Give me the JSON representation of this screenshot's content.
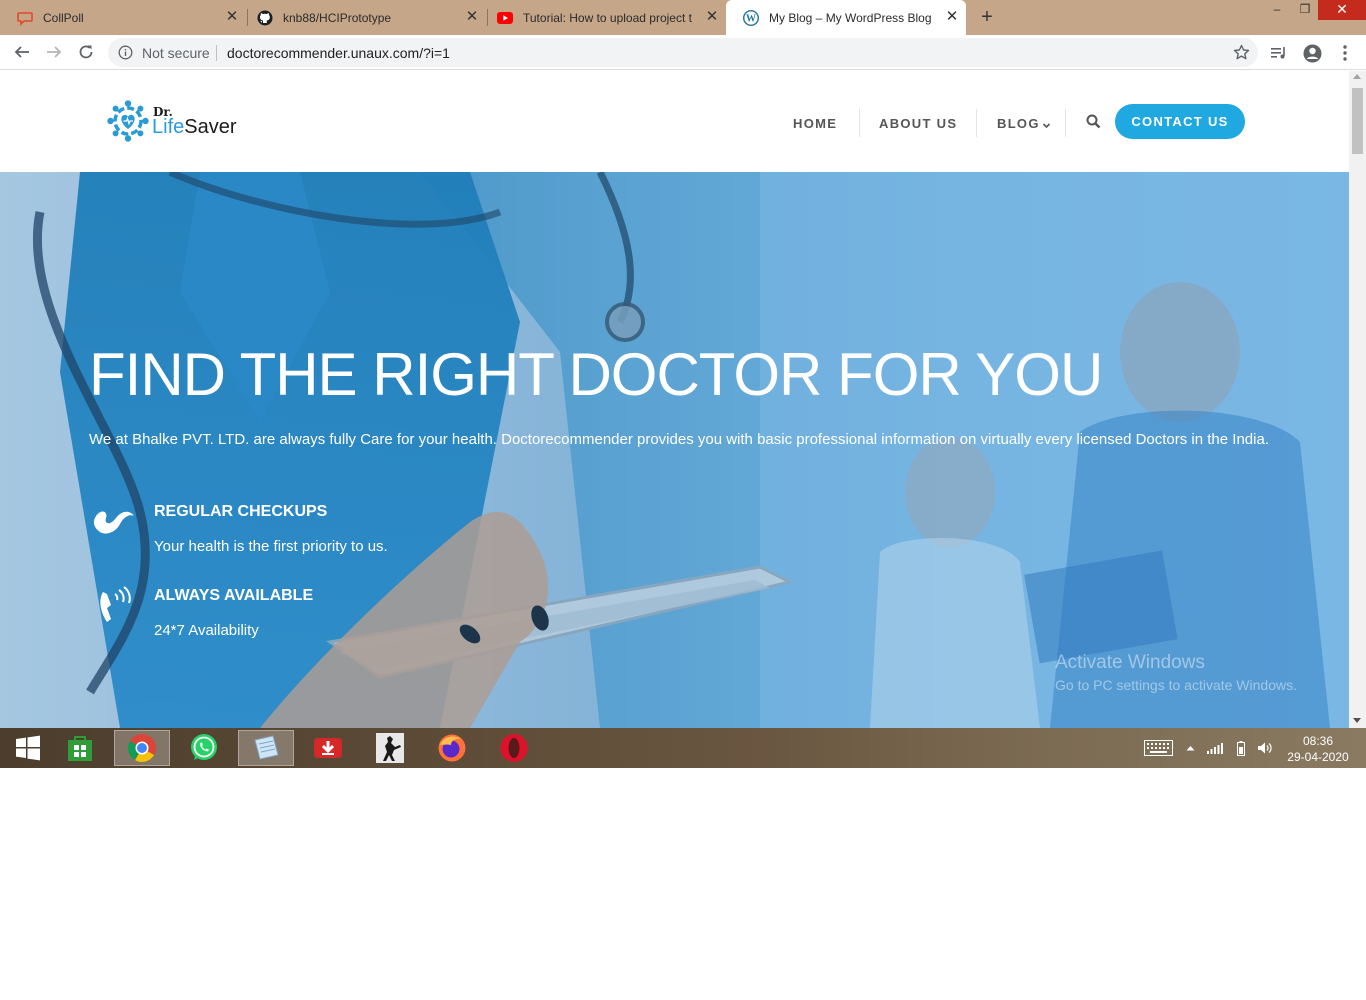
{
  "browser": {
    "tabs": [
      {
        "title": "CollPoll",
        "icon": "collpoll-icon"
      },
      {
        "title": "knb88/HCIPrototype",
        "icon": "github-icon"
      },
      {
        "title": "Tutorial: How to upload project t",
        "icon": "youtube-icon"
      },
      {
        "title": "My Blog – My WordPress Blog",
        "icon": "wordpress-icon",
        "active": true
      }
    ],
    "new_tab": "+",
    "window_controls": {
      "minimize": "–",
      "restore": "❐",
      "close": "✕"
    },
    "address": {
      "security": "Not secure",
      "url": "doctorecommender.unaux.com/?i=1"
    }
  },
  "site": {
    "logo": {
      "dr": "Dr.",
      "life": "Life",
      "saver": "Saver"
    },
    "nav": [
      {
        "label": "HOME"
      },
      {
        "label": "ABOUT US"
      },
      {
        "label": "BLOG"
      }
    ],
    "contact_button": "CONTACT US",
    "hero": {
      "title": "FIND THE RIGHT DOCTOR FOR YOU",
      "description": "We at Bhalke PVT. LTD. are always fully Care for your health. Doctorecommender provides you with basic professional information on virtually every licensed Doctors in the India.",
      "features": [
        {
          "title": "REGULAR CHECKUPS",
          "text": "Your health is the first priority to us.",
          "icon": "checkup-icon"
        },
        {
          "title": "ALWAYS AVAILABLE",
          "text": "24*7 Availability",
          "icon": "phone-icon"
        }
      ]
    },
    "watermark": {
      "title": "Activate Windows",
      "subtitle": "Go to PC settings to activate Windows."
    }
  },
  "taskbar": {
    "apps": [
      "windows-start-icon",
      "store-icon",
      "chrome-icon",
      "whatsapp-icon",
      "notepad-icon",
      "download-manager-icon",
      "counter-strike-icon",
      "firefox-icon",
      "opera-icon"
    ],
    "clock": {
      "time": "08:36",
      "date": "29-04-2020"
    }
  },
  "colors": {
    "accent": "#20a8e0",
    "logo_blue": "#2b9bd6",
    "close_red": "#c42b1c"
  }
}
